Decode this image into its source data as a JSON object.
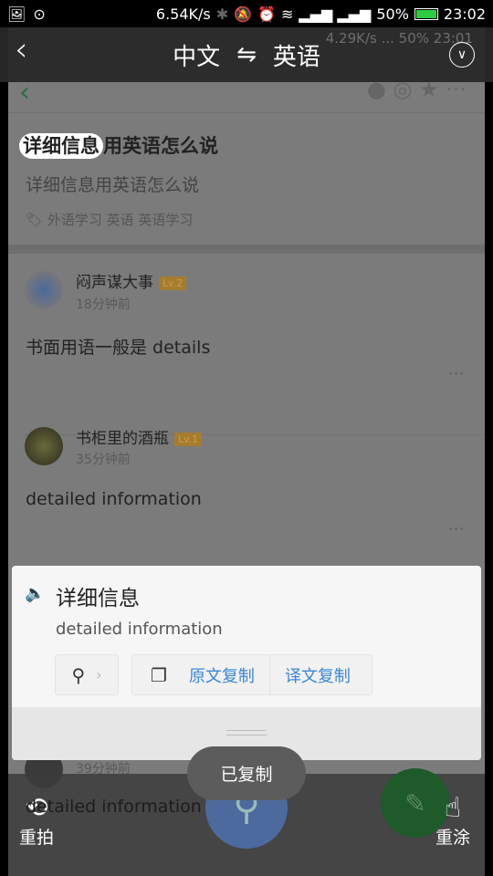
{
  "status_bar": {
    "speed": "6.54K/s",
    "battery": "50%",
    "time": "23:02"
  },
  "overlay": {
    "title_source": "中文",
    "swap_symbol": "⇋",
    "title_target": "英语"
  },
  "background": {
    "ghost_status": "4.29K/s  ...  50%  23:01",
    "question_title": "详细信息用英语怎么说",
    "highlighted": "详细信息",
    "title_rest": "用英语怎么说",
    "question_body": "详细信息用英语怎么说",
    "tags": "外语学习  英语  英语学习",
    "answers": [
      {
        "user": "闷声谋大事",
        "level": "Lv.2",
        "time": "18分钟前",
        "text": "书面用语一般是  details"
      },
      {
        "user": "书柜里的酒瓶",
        "level": "Lv.1",
        "time": "35分钟前",
        "text": "detailed information"
      },
      {
        "time": "39分钟前",
        "text": "detailed information"
      }
    ]
  },
  "card": {
    "source": "详细信息",
    "translation": "detailed information",
    "copy_source": "原文复制",
    "copy_translation": "译文复制"
  },
  "toast": "已复制",
  "bottom": {
    "retake": "重拍",
    "repaint": "重涂"
  },
  "colors": {
    "link": "#3a86d8",
    "battery": "#2ecc40"
  }
}
